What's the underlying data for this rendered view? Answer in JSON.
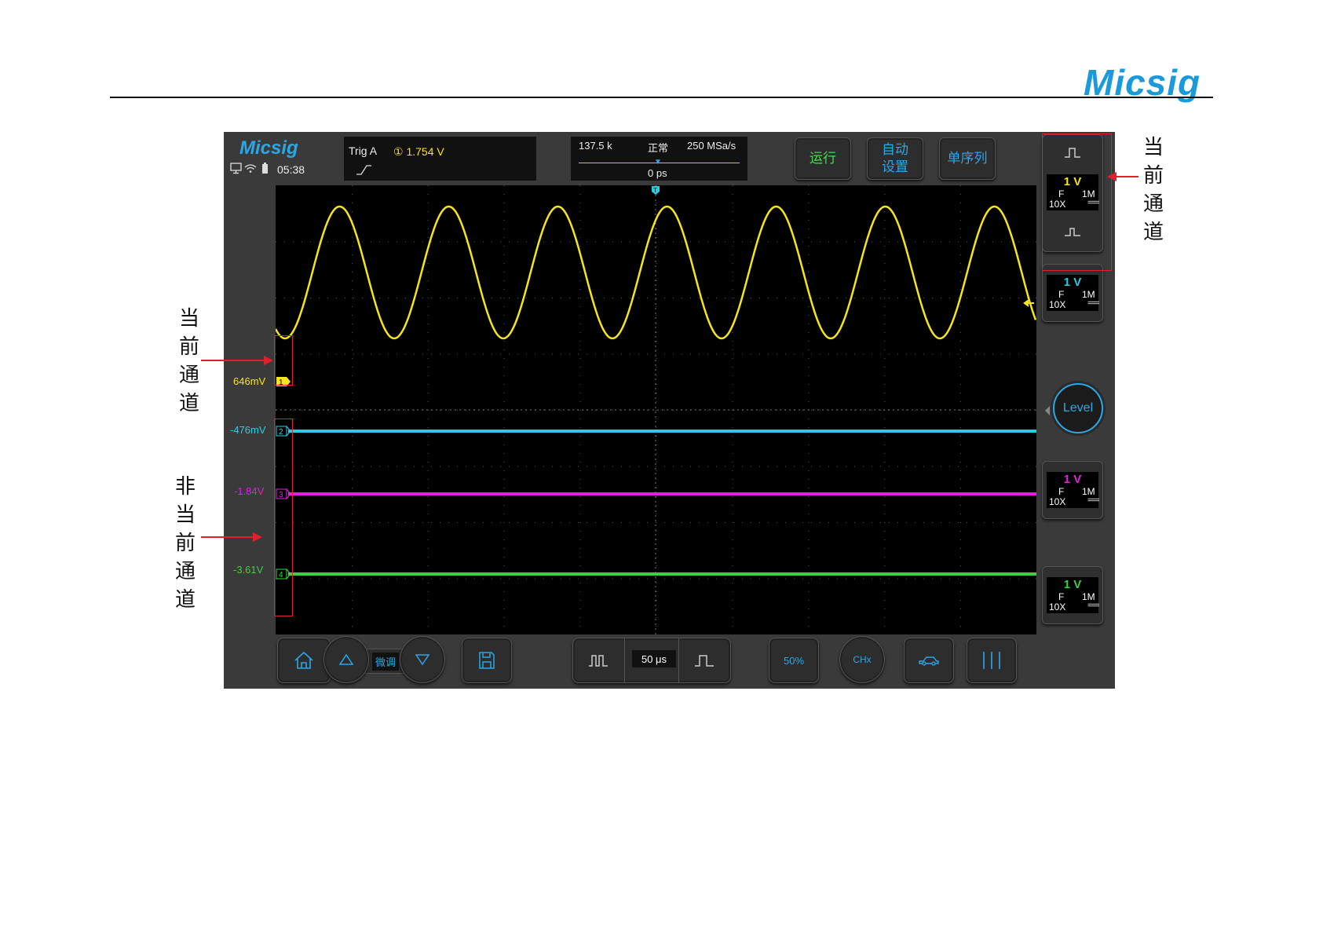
{
  "page": {
    "brand": "Micsig"
  },
  "device": {
    "brand": "Micsig",
    "time": "05:38",
    "trigger": {
      "label": "Trig  A",
      "source_value": "① 1.754  V",
      "edge_icon": "rising-edge-icon"
    },
    "acquisition": {
      "frequency": "137.5 k",
      "mode": "正常",
      "sample_rate": "250 MSa/s",
      "delay": "0 ps"
    },
    "buttons": {
      "run": "运行",
      "auto_setup_line1": "自动",
      "auto_setup_line2": "设置",
      "single": "单序列"
    },
    "channels": [
      {
        "id": "1",
        "offset": "646mV",
        "volts": "1 V",
        "coupling": "F",
        "impedance": "1M",
        "probe": "10X",
        "dc": "===",
        "color": "#f5e51a"
      },
      {
        "id": "2",
        "offset": "-476mV",
        "volts": "1 V",
        "coupling": "F",
        "impedance": "1M",
        "probe": "10X",
        "dc": "===",
        "color": "#24cfe6"
      },
      {
        "id": "3",
        "offset": "-1.84V",
        "volts": "1 V",
        "coupling": "F",
        "impedance": "1M",
        "probe": "10X",
        "dc": "===",
        "color": "#e51fe0"
      },
      {
        "id": "4",
        "offset": "-3.61V",
        "volts": "1 V",
        "coupling": "F",
        "impedance": "1M",
        "probe": "10X",
        "dc": "===",
        "color": "#34d63a"
      }
    ],
    "level_knob": "Level",
    "bottom": {
      "fine_label": "微调",
      "timebase": "50 μs",
      "fifty_percent": "50%",
      "chx": "CHx"
    }
  },
  "annotations": {
    "current_channel_right": [
      "当",
      "前",
      "通",
      "道"
    ],
    "current_channel_left": [
      "当",
      "前",
      "通",
      "道"
    ],
    "non_current_channel_left": [
      "非",
      "当",
      "前",
      "通",
      "道"
    ]
  }
}
